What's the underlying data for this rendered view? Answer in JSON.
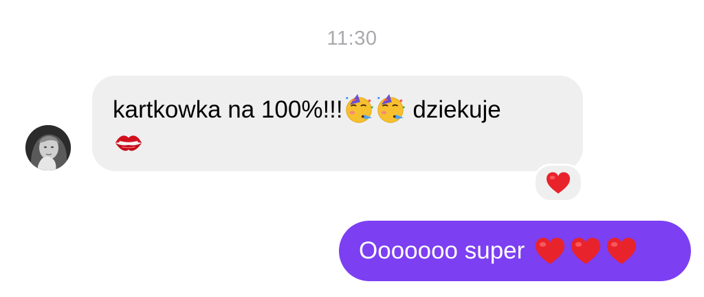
{
  "timestamp": "11:30",
  "incoming": {
    "line1": "kartkowka na 100%!!!",
    "line1_after": " dziekuje",
    "emojis": [
      "partying-face-emoji",
      "partying-face-emoji",
      "kiss-mark-emoji"
    ],
    "reaction": "red-heart-emoji",
    "bubble_color": "#efefef"
  },
  "outgoing": {
    "text": "Ooooooo super",
    "emojis": [
      "red-heart-emoji",
      "red-heart-emoji",
      "red-heart-emoji"
    ],
    "bubble_color": "#7c3ff2",
    "text_color": "#ffffff"
  },
  "colors": {
    "timestamp": "#a8a8ad",
    "heart": "#e8232b"
  }
}
